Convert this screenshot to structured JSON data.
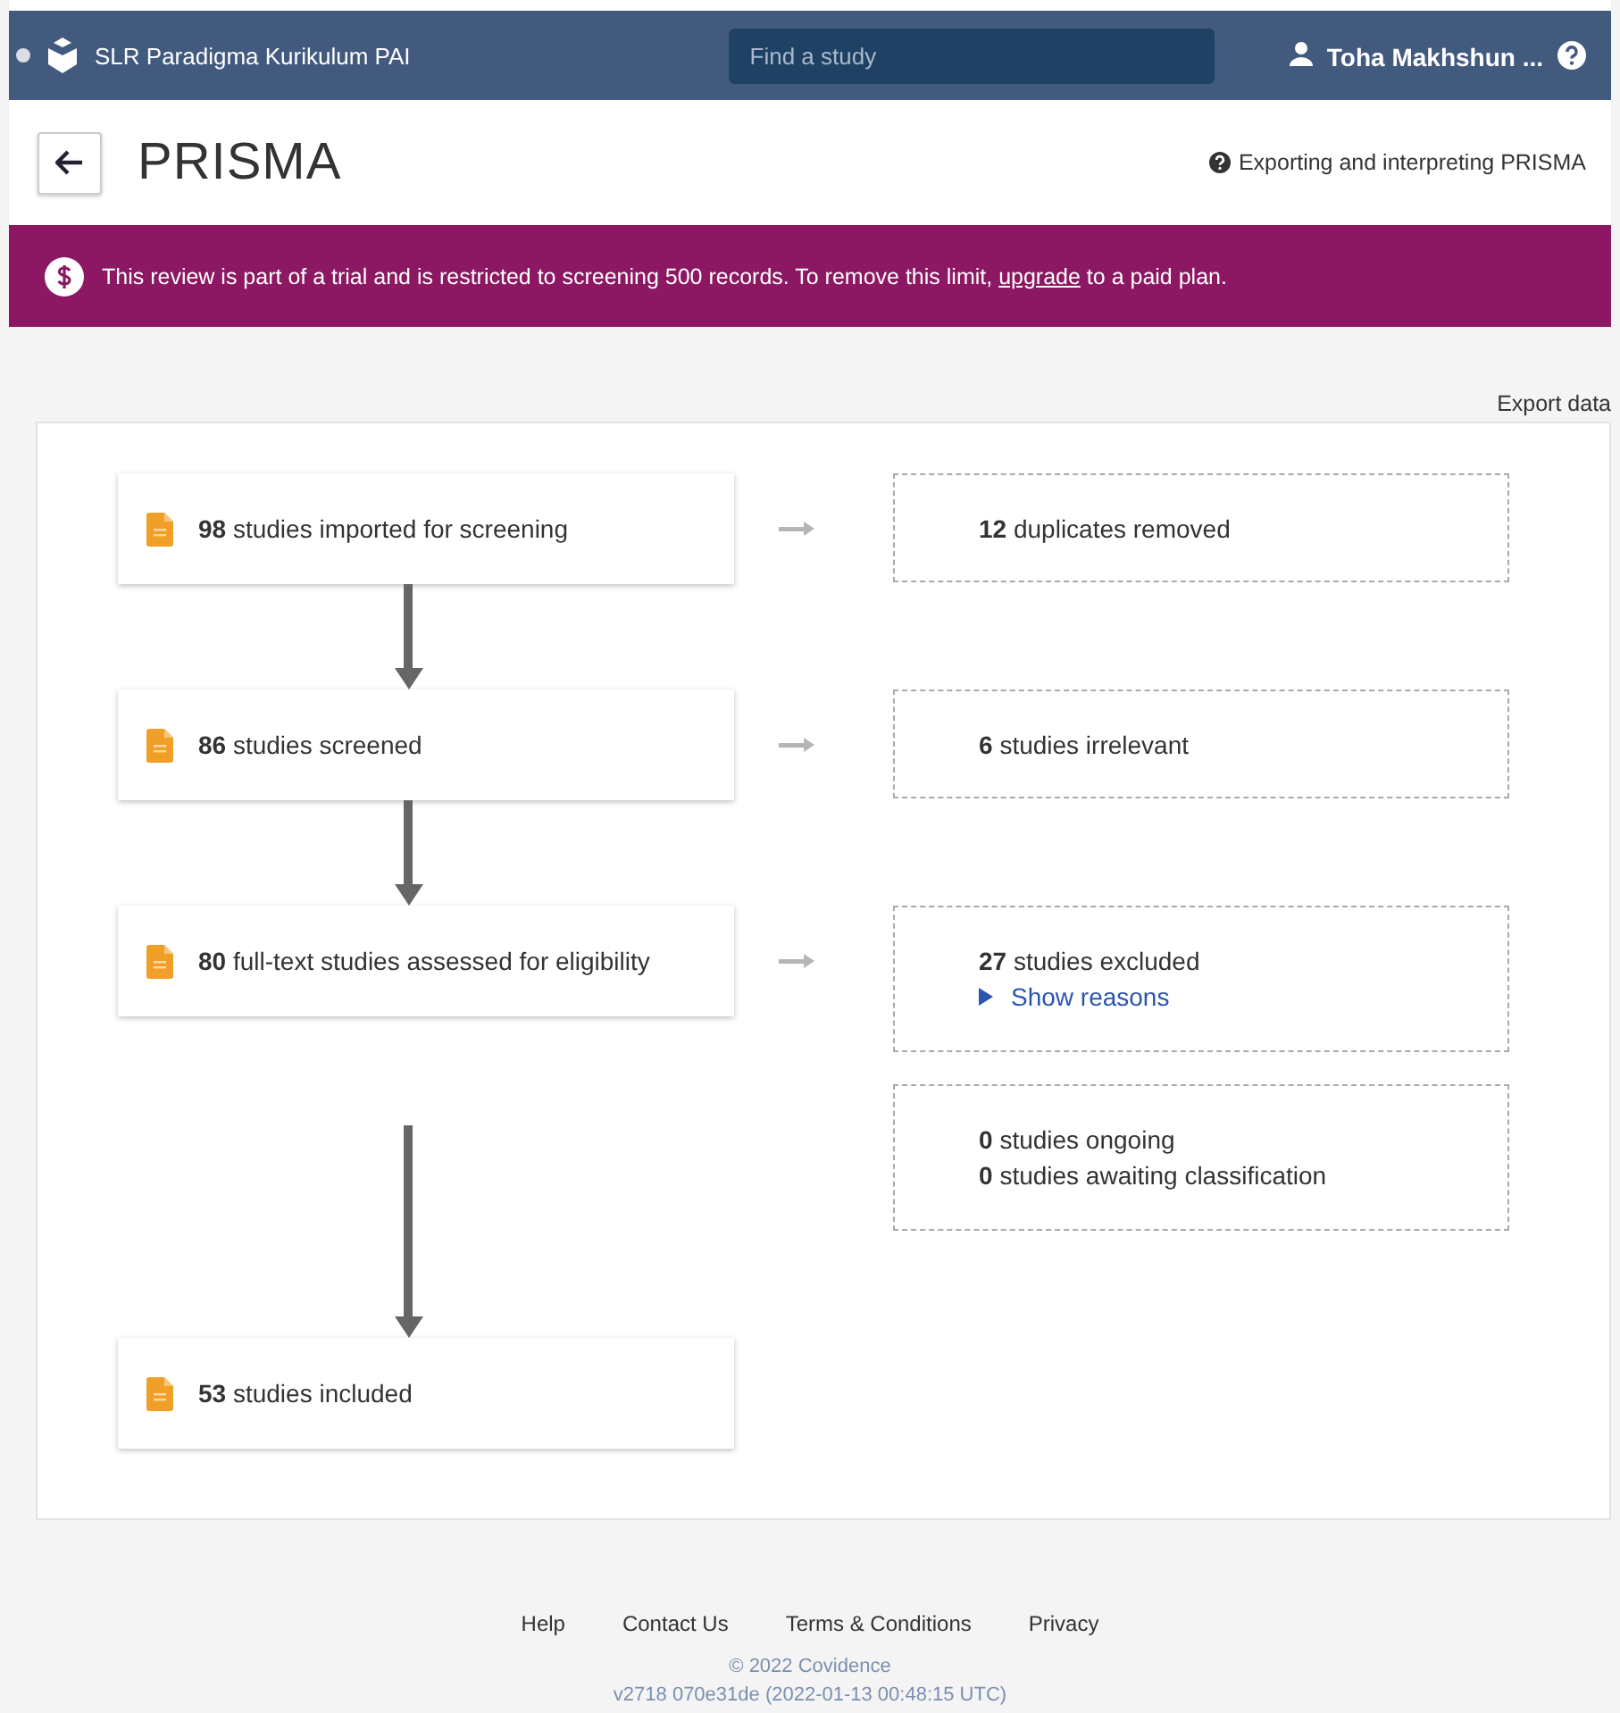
{
  "header": {
    "project": "SLR Paradigma Kurikulum PAI",
    "search": {
      "placeholder": "Find a study"
    },
    "user": "Toha Makhshun ..."
  },
  "page": {
    "title": "PRISMA",
    "help_link": "Exporting and interpreting PRISMA"
  },
  "banner": {
    "before": "This review is part of a trial and is restricted to screening 500 records. To remove this limit,",
    "link": "upgrade",
    "after": "to a paid plan."
  },
  "export_link": "Export data",
  "flow": [
    {
      "count": "98",
      "label": "studies imported for screening",
      "side": [
        {
          "lines": [
            {
              "count": "12",
              "label": "duplicates removed"
            }
          ]
        }
      ]
    },
    {
      "count": "86",
      "label": "studies screened",
      "side": [
        {
          "lines": [
            {
              "count": "6",
              "label": "studies irrelevant"
            }
          ]
        }
      ]
    },
    {
      "count": "80",
      "label": "full-text studies assessed for eligibility",
      "side": [
        {
          "lines": [
            {
              "count": "27",
              "label": "studies excluded"
            }
          ],
          "toggle": {
            "label": "Show reasons",
            "expanded": false
          }
        },
        {
          "lines": [
            {
              "count": "0",
              "label": "studies ongoing"
            },
            {
              "count": "0",
              "label": "studies awaiting classification"
            }
          ]
        }
      ]
    },
    {
      "count": "53",
      "label": "studies included"
    }
  ],
  "footer": {
    "links": [
      "Help",
      "Contact Us",
      "Terms & Conditions",
      "Privacy"
    ],
    "copyright": "© 2022 Covidence",
    "version": "v2718 070e31de (2022-01-13 00:48:15 UTC)"
  }
}
